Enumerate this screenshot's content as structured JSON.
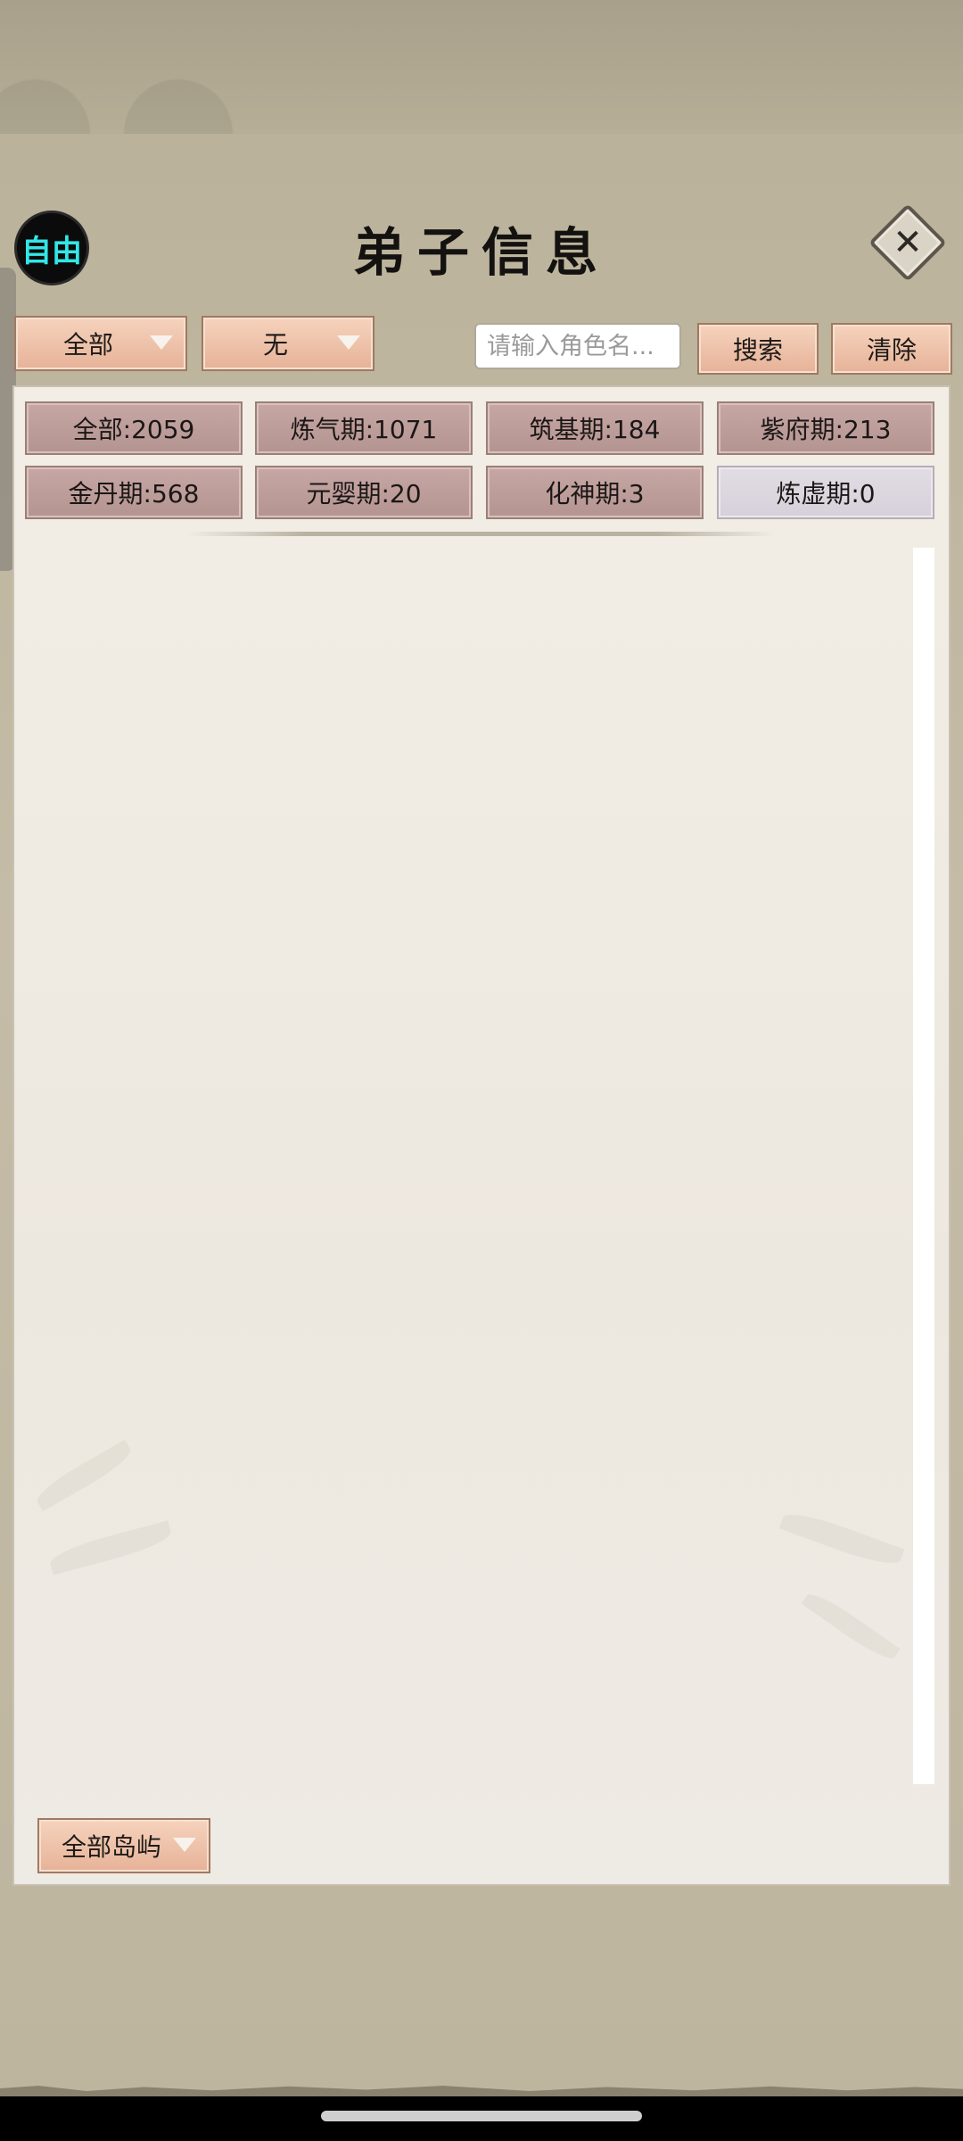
{
  "header": {
    "mode_badge": "自由",
    "title": "弟子信息",
    "close_symbol": "✕"
  },
  "toolbar": {
    "filter_dropdown": "全部",
    "sub_filter_dropdown": "无",
    "search_placeholder": "请输入角色名...",
    "search_button": "搜索",
    "clear_button": "清除"
  },
  "ranks": [
    {
      "label": "全部:2059"
    },
    {
      "label": "炼气期:1071"
    },
    {
      "label": "筑基期:184"
    },
    {
      "label": "紫府期:213"
    },
    {
      "label": "金丹期:568"
    },
    {
      "label": "元婴期:20"
    },
    {
      "label": "化神期:3"
    },
    {
      "label": "炼虚期:0"
    }
  ],
  "footer": {
    "island_dropdown": "全部岛屿"
  },
  "colors": {
    "badge_text": "#33e6e6",
    "peach_button": "#f0c4aa",
    "rank_button": "#bf9f9c",
    "rank_button_inactive": "#ddd8e0"
  }
}
